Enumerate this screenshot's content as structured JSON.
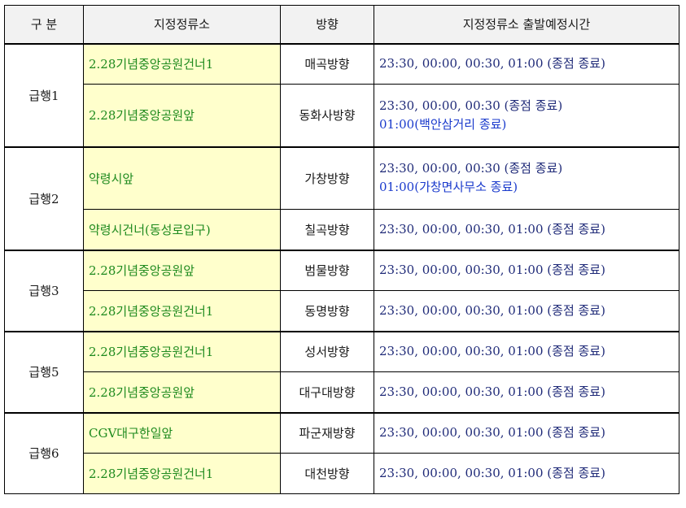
{
  "header": {
    "col_group": "구  분",
    "col_stop": "지정정류소",
    "col_dir": "방향",
    "col_time": "지정정류소 출발예정시간"
  },
  "groups": [
    {
      "name": "급행1",
      "rows": [
        {
          "stop": "2.28기념중앙공원건너1",
          "direction": "매곡방향",
          "time": "23:30, 00:00, 00:30, 01:00 (종점 종료)"
        },
        {
          "stop": "2.28기념중앙공원앞",
          "direction": "동화사방향",
          "time": "23:30, 00:00, 00:30 (종점 종료)",
          "time2": "01:00(백안삼거리 종료)"
        }
      ]
    },
    {
      "name": "급행2",
      "rows": [
        {
          "stop": "약령시앞",
          "direction": "가창방향",
          "time": "23:30, 00:00, 00:30 (종점 종료)",
          "time2": "01:00(가창면사무소 종료)"
        },
        {
          "stop": "약령시건너(동성로입구)",
          "direction": "칠곡방향",
          "time": "23:30, 00:00, 00:30, 01:00 (종점 종료)"
        }
      ]
    },
    {
      "name": "급행3",
      "rows": [
        {
          "stop": "2.28기념중앙공원앞",
          "direction": "범물방향",
          "time": "23:30, 00:00, 00:30, 01:00 (종점 종료)"
        },
        {
          "stop": "2.28기념중앙공원건너1",
          "direction": "동명방향",
          "time": "23:30, 00:00, 00:30, 01:00 (종점 종료)"
        }
      ]
    },
    {
      "name": "급행5",
      "rows": [
        {
          "stop": "2.28기념중앙공원건너1",
          "direction": "성서방향",
          "time": "23:30, 00:00, 00:30, 01:00 (종점 종료)"
        },
        {
          "stop": "2.28기념중앙공원앞",
          "direction": "대구대방향",
          "time": "23:30, 00:00, 00:30, 01:00 (종점 종료)"
        }
      ]
    },
    {
      "name": "급행6",
      "rows": [
        {
          "stop": "CGV대구한일앞",
          "direction": "파군재방향",
          "time": "23:30, 00:00, 00:30, 01:00 (종점 종료)"
        },
        {
          "stop": "2.28기념중앙공원건너1",
          "direction": "대천방향",
          "time": "23:30, 00:00, 00:30, 01:00 (종점 종료)"
        }
      ]
    }
  ],
  "colors": {
    "stop_bg": "#ffffcc",
    "stop_text": "#1e8a1e",
    "time_text": "#1f2a78",
    "time_alt_text": "#1a3acc",
    "header_bg": "#f2f2f2"
  }
}
